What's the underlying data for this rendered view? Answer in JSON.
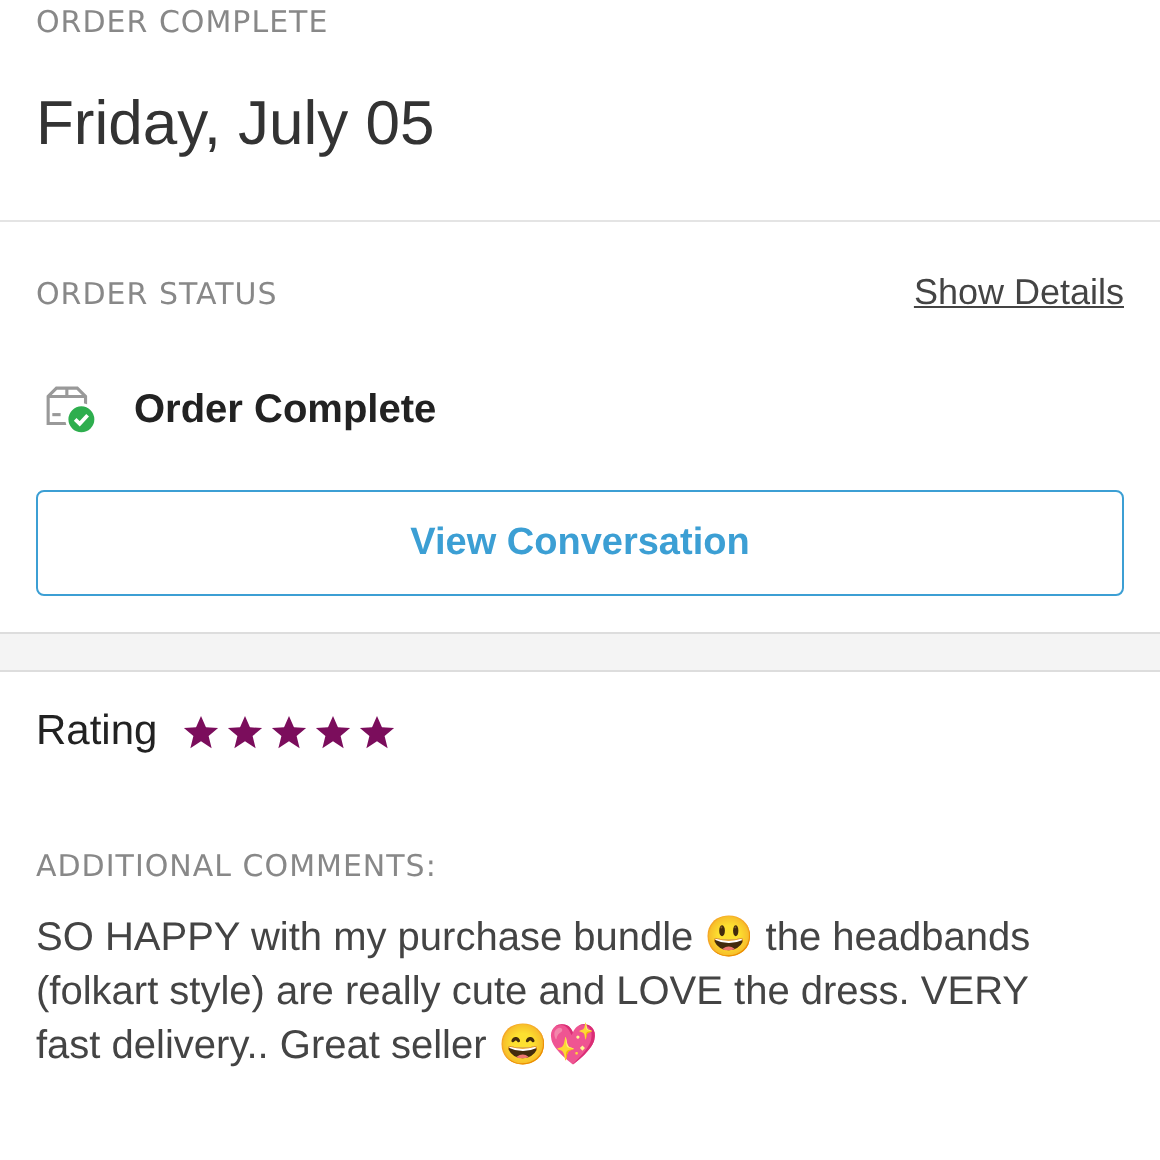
{
  "header": {
    "label": "ORDER COMPLETE",
    "date": "Friday, July 05"
  },
  "order_status": {
    "label": "ORDER STATUS",
    "link": "Show Details",
    "status": "Order Complete",
    "complete": true
  },
  "button": "View Conversation",
  "rating": {
    "label": "Rating",
    "stars": 5
  },
  "comments": {
    "label": "ADDITIONAL COMMENTS:",
    "text": "SO HAPPY with my purchase bundle 😃 the headbands (folkart style) are really cute and LOVE the dress. VERY fast delivery.. Great seller 😄💖"
  }
}
